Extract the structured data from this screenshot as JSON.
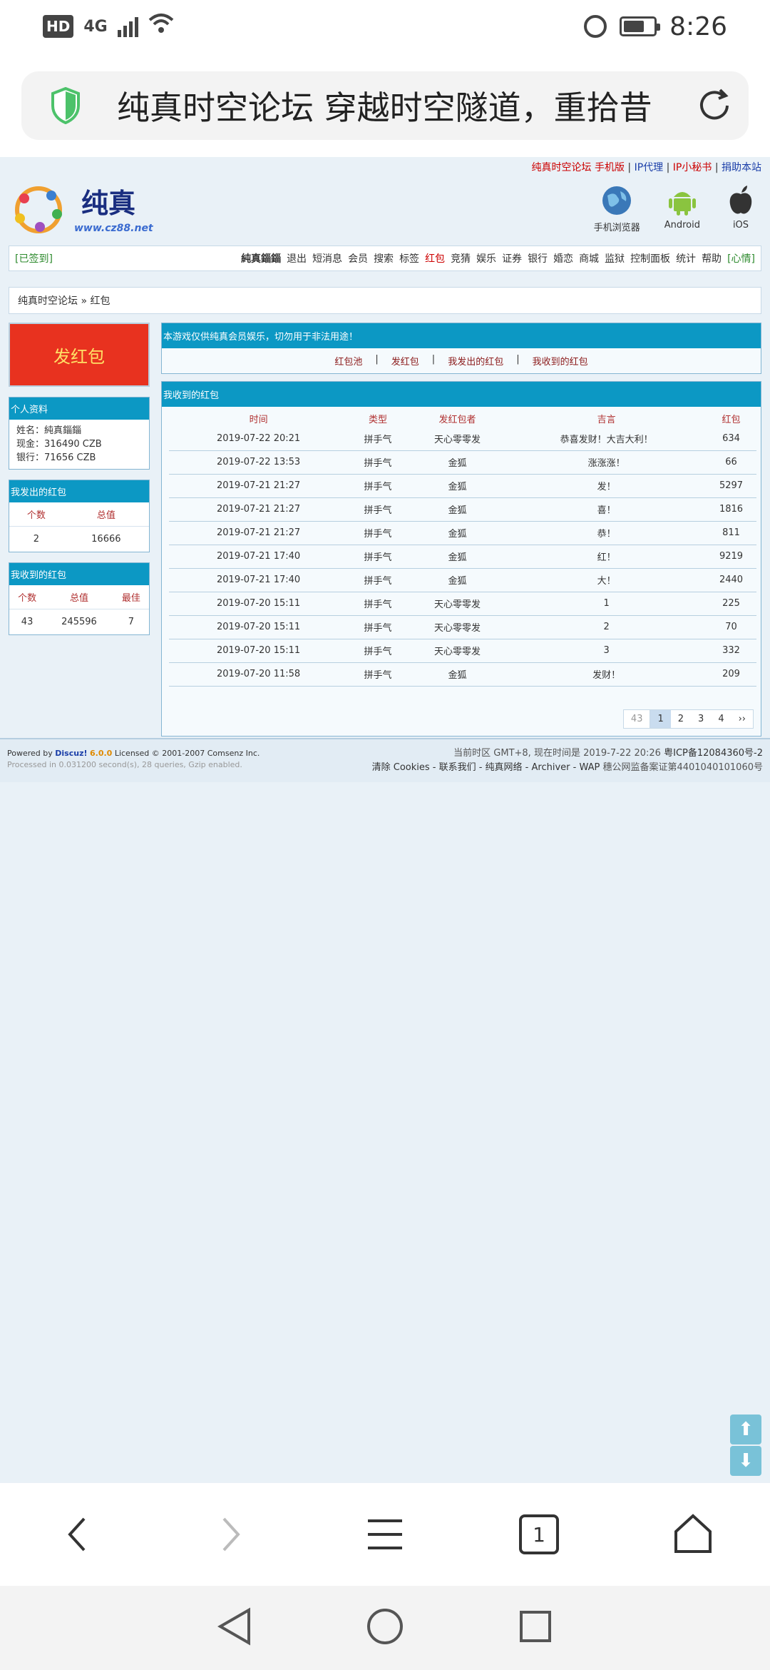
{
  "status": {
    "hd": "HD",
    "net": "4G",
    "time": "8:26"
  },
  "url": {
    "title": "纯真时空论坛 穿越时空隧道，重拾昔"
  },
  "toplinks": {
    "forum": "纯真时空论坛",
    "mobile": "手机版",
    "sep1": " | ",
    "ip": "IP代理",
    "sep2": " | ",
    "sec": "IP小秘书",
    "sep3": " | ",
    "donate": "捐助本站"
  },
  "logo": {
    "text": "纯真",
    "sub": "www.cz88.net"
  },
  "platforms": [
    {
      "label": "手机浏览器",
      "icon": "globe-icon"
    },
    {
      "label": "Android",
      "icon": "android-icon"
    },
    {
      "label": "iOS",
      "icon": "apple-icon"
    }
  ],
  "nav": {
    "signed": "[已签到]",
    "user": "純真錙錙",
    "links": [
      "退出",
      "短消息",
      "会员",
      "搜索",
      "标签",
      "红包",
      "竞猜",
      "娱乐",
      "证券",
      "银行",
      "婚恋",
      "商城",
      "监狱",
      "控制面板",
      "统计",
      "帮助"
    ],
    "mood": "[心情]"
  },
  "breadcrumb": "纯真时空论坛 » 红包",
  "sidebar": {
    "send_button": "发红包",
    "profile": {
      "title": "个人资料",
      "name": "姓名：純真錙錙",
      "cash": "现金：316490 CZB",
      "bank": "银行：71656 CZB"
    },
    "sent": {
      "title": "我发出的红包",
      "headers": [
        "个数",
        "总值"
      ],
      "values": [
        "2",
        "16666"
      ]
    },
    "received": {
      "title": "我收到的红包",
      "headers": [
        "个数",
        "总值",
        "最佳"
      ],
      "values": [
        "43",
        "245596",
        "7"
      ]
    }
  },
  "notice": {
    "text": "本游戏仅供纯真会员娱乐，切勿用于非法用途！",
    "tabs": [
      "红包池",
      "发红包",
      "我发出的红包",
      "我收到的红包"
    ]
  },
  "received": {
    "title": "我收到的红包",
    "headers": [
      "时间",
      "类型",
      "发红包者",
      "吉言",
      "红包"
    ],
    "rows": [
      [
        "2019-07-22 20:21",
        "拼手气",
        "天心零零发",
        "恭喜发财！大吉大利！",
        "634"
      ],
      [
        "2019-07-22 13:53",
        "拼手气",
        "金狐",
        "涨涨涨！",
        "66"
      ],
      [
        "2019-07-21 21:27",
        "拼手气",
        "金狐",
        "发！",
        "5297"
      ],
      [
        "2019-07-21 21:27",
        "拼手气",
        "金狐",
        "喜！",
        "1816"
      ],
      [
        "2019-07-21 21:27",
        "拼手气",
        "金狐",
        "恭！",
        "811"
      ],
      [
        "2019-07-21 17:40",
        "拼手气",
        "金狐",
        "红！",
        "9219"
      ],
      [
        "2019-07-21 17:40",
        "拼手气",
        "金狐",
        "大！",
        "2440"
      ],
      [
        "2019-07-20 15:11",
        "拼手气",
        "天心零零发",
        "1",
        "225"
      ],
      [
        "2019-07-20 15:11",
        "拼手气",
        "天心零零发",
        "2",
        "70"
      ],
      [
        "2019-07-20 15:11",
        "拼手气",
        "天心零零发",
        "3",
        "332"
      ],
      [
        "2019-07-20 11:58",
        "拼手气",
        "金狐",
        "发财！",
        "209"
      ]
    ],
    "pager": {
      "total": "43",
      "pages": [
        "1",
        "2",
        "3",
        "4"
      ],
      "next": "››"
    }
  },
  "footer": {
    "powered": "Powered by",
    "discuz": "Discuz!",
    "version": "6.0.0",
    "licensed": "Licensed",
    "copy": "© 2001-2007",
    "comsenz": "Comsenz Inc.",
    "processed": "Processed in 0.031200 second(s), 28 queries, Gzip enabled.",
    "timezone": "当前时区 GMT+8, 现在时间是 2019-7-22 20:26",
    "icp": "粤ICP备12084360号-2",
    "links": "清除 Cookies - 联系我们 - 纯真网络 - Archiver - WAP",
    "police": "穗公网监备案证第4401040101060号"
  },
  "bottom": {
    "tab_count": "1"
  }
}
